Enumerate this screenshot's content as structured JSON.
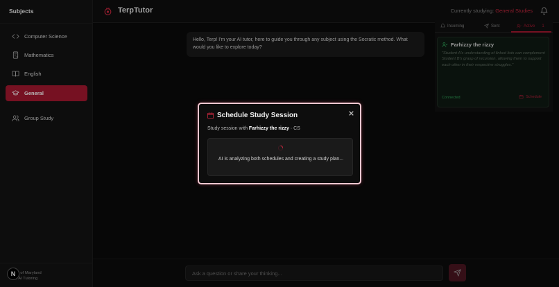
{
  "sidebar": {
    "title": "Subjects",
    "items": [
      {
        "label": "Computer Science",
        "icon": "code-icon"
      },
      {
        "label": "Mathematics",
        "icon": "calculator-icon"
      },
      {
        "label": "English",
        "icon": "book-open-icon"
      },
      {
        "label": "General",
        "icon": "graduation-cap-icon",
        "active": true
      },
      {
        "label": "Group Study",
        "icon": "users-icon"
      }
    ],
    "footer": {
      "line1": "ity of Maryland",
      "line2": "c AI Tutoring"
    },
    "badge": "N"
  },
  "header": {
    "brand": "TerpTutor",
    "studying_label": "Currently studying:",
    "studying_subject": "General Studies"
  },
  "chat": {
    "greeting": "Hello, Terp! I'm your AI tutor, here to guide you through any subject using the Socratic method. What would you like to explore today?",
    "input_placeholder": "Ask a question or share your thinking..."
  },
  "panel": {
    "tabs": [
      {
        "label": "Incoming"
      },
      {
        "label": "Sent"
      },
      {
        "label": "Active",
        "count": "1",
        "active": true
      }
    ],
    "connection": {
      "name": "Farhizzy the rizzy",
      "quote": "\"Student A's understanding of linked lists can complement Student B's grasp of recursion, allowing them to support each other in their respective struggles.\"",
      "status": "Connected",
      "schedule_label": "Schedule"
    }
  },
  "modal": {
    "title": "Schedule Study Session",
    "subtitle_prefix": "Study session with ",
    "partner": "Farhizzy the rizzy",
    "subtitle_suffix": " · CS",
    "message": "AI is analyzing both schedules and creating a study plan..."
  },
  "colors": {
    "accent": "#a41830",
    "accent_text": "#c2273d",
    "connected": "#2e9e55",
    "modal_border": "#f2c8d1"
  }
}
